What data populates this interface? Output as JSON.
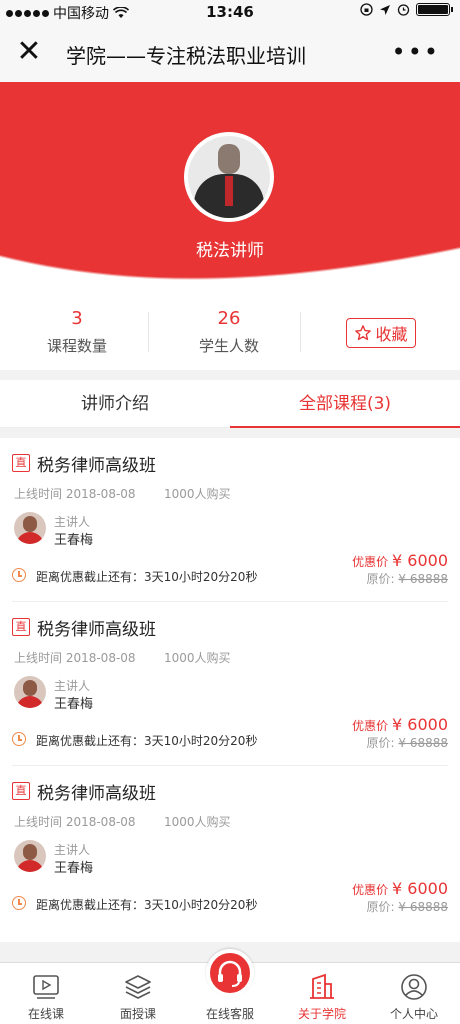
{
  "status_bar": {
    "carrier": "中国移动",
    "time": "13:46"
  },
  "nav": {
    "title": "学院——专注税法职业培训",
    "close_icon": "close-icon",
    "more_icon": "more-icon"
  },
  "teacher": {
    "name": "税法讲师"
  },
  "stats": {
    "courses_count": "3",
    "courses_label": "课程数量",
    "students_count": "26",
    "students_label": "学生人数",
    "favorite_label": "收藏"
  },
  "tabs": [
    {
      "label": "讲师介绍",
      "active": false
    },
    {
      "label": "全部课程(3)",
      "active": true
    }
  ],
  "courses": [
    {
      "badge": "直",
      "title": "税务律师高级班",
      "date": "上线时间 2018-08-08",
      "buyers": "1000人购买",
      "teacher_role": "主讲人",
      "teacher_name": "王春梅",
      "price_label": "优惠价",
      "price": "¥ 6000",
      "orig_label": "原价:",
      "orig_price": "¥ 68888",
      "countdown": "距离优惠截止还有：3天10小时20分20秒"
    },
    {
      "badge": "直",
      "title": "税务律师高级班",
      "date": "上线时间 2018-08-08",
      "buyers": "1000人购买",
      "teacher_role": "主讲人",
      "teacher_name": "王春梅",
      "price_label": "优惠价",
      "price": "¥ 6000",
      "orig_label": "原价:",
      "orig_price": "¥ 68888",
      "countdown": "距离优惠截止还有：3天10小时20分20秒"
    },
    {
      "badge": "直",
      "title": "税务律师高级班",
      "date": "上线时间 2018-08-08",
      "buyers": "1000人购买",
      "teacher_role": "主讲人",
      "teacher_name": "王春梅",
      "price_label": "优惠价",
      "price": "¥ 6000",
      "orig_label": "原价:",
      "orig_price": "¥ 68888",
      "countdown": "距离优惠截止还有：3天10小时20分20秒"
    }
  ],
  "bottom_nav": [
    {
      "label": "在线课",
      "icon": "video-icon",
      "active": false
    },
    {
      "label": "面授课",
      "icon": "layers-icon",
      "active": false
    },
    {
      "label": "在线客服",
      "icon": "headset-icon",
      "active": false
    },
    {
      "label": "关于学院",
      "icon": "building-icon",
      "active": true
    },
    {
      "label": "个人中心",
      "icon": "user-icon",
      "active": false
    }
  ],
  "colors": {
    "accent": "#e83434",
    "clock": "#f08a4b"
  }
}
